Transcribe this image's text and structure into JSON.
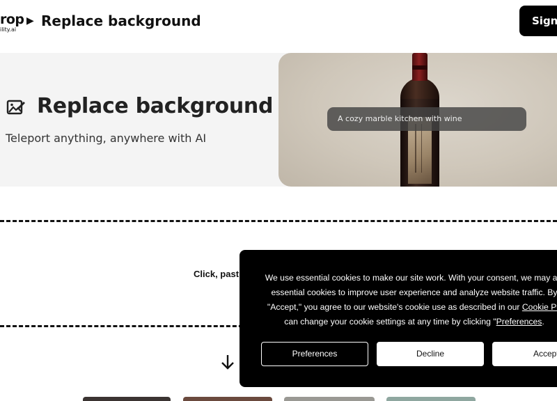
{
  "header": {
    "logo_main": "rop",
    "logo_sub": "ility.ai",
    "breadcrumb_separator": "▶",
    "breadcrumb_title": "Replace background",
    "signin_label": "Sign-"
  },
  "hero": {
    "icon": "image-edit-icon",
    "title": "Replace background",
    "subtitle": "Teleport anything, anywhere with AI",
    "image_prompt": "A cozy marble kitchen with wine"
  },
  "upload": {
    "instruction": "Click, past",
    "arrow_icon": "arrow-down-icon"
  },
  "cookie_banner": {
    "line1": "We use essential cookies to make our site work. With your consent, we may als",
    "line2": "essential cookies to improve user experience and analyze website traffic. By",
    "line3_prefix": "\"Accept,\" you agree to our website's cookie use as described in our ",
    "line3_link": "Cookie Po",
    "line4_prefix": "can change your cookie settings at any time by clicking \"",
    "line4_link": "Preferences",
    "line4_suffix": ".",
    "preferences_label": "Preferences",
    "decline_label": "Decline",
    "accept_label": "Accept"
  },
  "colors": {
    "cookie_bg": "#000000",
    "hero_bg": "#f4f4f4",
    "signin_bg": "#000000"
  }
}
